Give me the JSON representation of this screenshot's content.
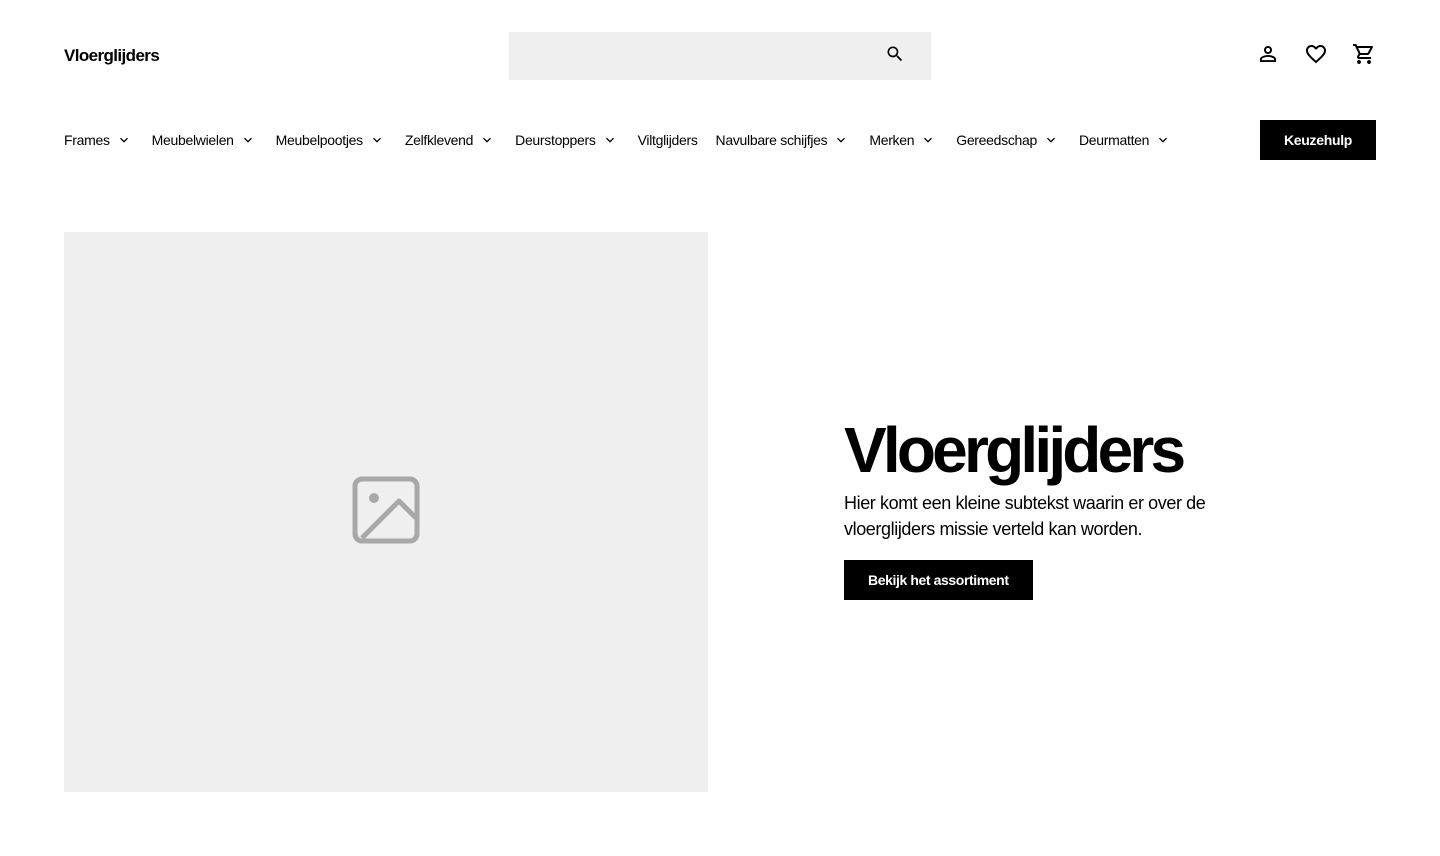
{
  "header": {
    "logo": "Vloerglijders",
    "search": {
      "placeholder": "",
      "value": ""
    },
    "icons": [
      "account-icon",
      "heart-icon",
      "cart-icon"
    ]
  },
  "nav": {
    "items": [
      {
        "label": "Frames",
        "has_dropdown": true
      },
      {
        "label": "Meubelwielen",
        "has_dropdown": true
      },
      {
        "label": "Meubelpootjes",
        "has_dropdown": true
      },
      {
        "label": "Zelfklevend",
        "has_dropdown": true
      },
      {
        "label": "Deurstoppers",
        "has_dropdown": true
      },
      {
        "label": "Viltglijders",
        "has_dropdown": false
      },
      {
        "label": "Navulbare schijfjes",
        "has_dropdown": true
      },
      {
        "label": "Merken",
        "has_dropdown": true
      },
      {
        "label": "Gereedschap",
        "has_dropdown": true
      },
      {
        "label": "Deurmatten",
        "has_dropdown": true
      }
    ],
    "cta_label": "Keuzehulp"
  },
  "hero": {
    "title": "Vloerglijders",
    "subtitle": "Hier komt een kleine subtekst waarin er over de vloerglijders missie verteld kan worden.",
    "button_label": "Bekijk het assortiment",
    "image_icon": "image-placeholder-icon"
  },
  "colors": {
    "primary": "#000000",
    "background": "#ffffff",
    "placeholder_bg": "#efefef",
    "placeholder_icon": "#a8a8a8"
  }
}
